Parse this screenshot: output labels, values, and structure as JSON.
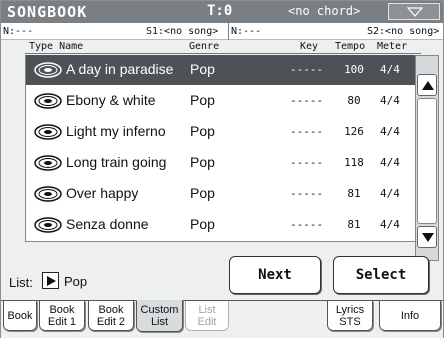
{
  "header": {
    "app_title": "SONGBOOK",
    "track": "T:0",
    "chord": "<no chord>",
    "menu_icon": "triangle-down-icon"
  },
  "status": {
    "left_label": "N:---",
    "s1": "S1:<no song>",
    "right_label": "N:---",
    "s2": "S2:<no song>"
  },
  "columns": {
    "type_name": "Type Name",
    "genre": "Genre",
    "key": "Key",
    "tempo": "Tempo",
    "meter": "Meter"
  },
  "songs": [
    {
      "name": "A day in paradise",
      "genre": "Pop",
      "key": "-----",
      "tempo": "100",
      "meter": "4/4",
      "type_icon": "disc-icon",
      "selected": true
    },
    {
      "name": "Ebony & white",
      "genre": "Pop",
      "key": "-----",
      "tempo": "80",
      "meter": "4/4",
      "type_icon": "disc-icon"
    },
    {
      "name": "Light my inferno",
      "genre": "Pop",
      "key": "-----",
      "tempo": "126",
      "meter": "4/4",
      "type_icon": "disc-icon"
    },
    {
      "name": "Long train going",
      "genre": "Pop",
      "key": "-----",
      "tempo": "118",
      "meter": "4/4",
      "type_icon": "disc-icon"
    },
    {
      "name": "Over happy",
      "genre": "Pop",
      "key": "-----",
      "tempo": "81",
      "meter": "4/4",
      "type_icon": "disc-icon"
    },
    {
      "name": "Senza donne",
      "genre": "Pop",
      "key": "-----",
      "tempo": "81",
      "meter": "4/4",
      "type_icon": "disc-icon"
    }
  ],
  "footer": {
    "list_label": "List:",
    "list_value": "Pop",
    "next_label": "Next",
    "select_label": "Select"
  },
  "tabs": [
    {
      "label": "Book"
    },
    {
      "label": "Book\nEdit 1"
    },
    {
      "label": "Book\nEdit 2"
    },
    {
      "label": "Custom\nList",
      "active": true
    },
    {
      "label": "List\nEdit",
      "disabled": true
    },
    {
      "label": "Lyrics\nSTS"
    },
    {
      "label": "Info"
    }
  ],
  "colors": {
    "titlebar": "#7a7f83",
    "selected_row": "#4d5256",
    "panel": "#eef0f0"
  }
}
